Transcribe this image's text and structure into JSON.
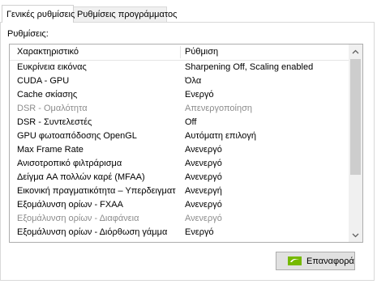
{
  "tabs": [
    {
      "label": "Γενικές ρυθμίσεις"
    },
    {
      "label": "Ρυθμίσεις προγράμματος"
    }
  ],
  "section_label": "Ρυθμίσεις:",
  "table": {
    "headers": [
      "Χαρακτηριστικό",
      "Ρύθμιση"
    ],
    "rows": [
      {
        "feature": "Ευκρίνεια εικόνας",
        "setting": "Sharpening Off, Scaling enabled",
        "disabled": false
      },
      {
        "feature": "CUDA - GPU",
        "setting": "Όλα",
        "disabled": false
      },
      {
        "feature": "Cache σκίασης",
        "setting": "Ενεργό",
        "disabled": false
      },
      {
        "feature": "DSR - Ομαλότητα",
        "setting": "Απενεργοποίηση",
        "disabled": true
      },
      {
        "feature": "DSR - Συντελεστές",
        "setting": "Off",
        "disabled": false
      },
      {
        "feature": "GPU φωτοαπόδοσης OpenGL",
        "setting": "Αυτόματη επιλογή",
        "disabled": false
      },
      {
        "feature": "Max Frame Rate",
        "setting": "Ανενεργό",
        "disabled": false
      },
      {
        "feature": "Ανισοτροπικό φιλτράρισμα",
        "setting": "Ανενεργό",
        "disabled": false
      },
      {
        "feature": "Δείγμα AA πολλών καρέ (MFAA)",
        "setting": "Ανενεργό",
        "disabled": false
      },
      {
        "feature": "Εικονική πραγματικότητα – Υπερδειγματολ...",
        "setting": "Ανενεργή",
        "disabled": false
      },
      {
        "feature": "Εξομάλυνση ορίων - FXAA",
        "setting": "Ανενεργό",
        "disabled": false
      },
      {
        "feature": "Εξομάλυνση ορίων - Διαφάνεια",
        "setting": "Ανενεργό",
        "disabled": true
      },
      {
        "feature": "Εξομάλυνση ορίων - Διόρθωση γάμμα",
        "setting": "Ενεργό",
        "disabled": false
      }
    ]
  },
  "scrollbar": {
    "up_icon": "chevron-up-icon",
    "down_icon": "chevron-down-icon",
    "position_fraction": 0.0
  },
  "restore_button": {
    "label": "Επαναφορά",
    "icon": "nvidia-logo-icon"
  },
  "colors": {
    "disabled_text": "#8c8c8c",
    "button_bg": "#e1e1e1",
    "nvidia_green": "#76b900"
  }
}
